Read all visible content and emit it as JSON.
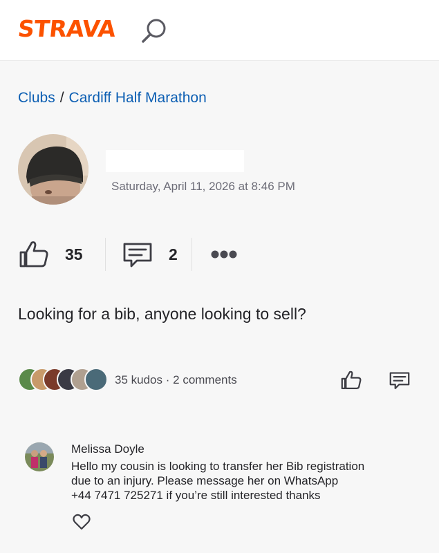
{
  "app": {
    "logo_text": "STRAVA",
    "brand_color": "#fc5200",
    "link_color": "#0d5fb3"
  },
  "header": {
    "search_icon": "search-icon"
  },
  "breadcrumb": {
    "parent": "Clubs",
    "separator": "/",
    "current": "Cardiff Half Marathon"
  },
  "post": {
    "author_name": "",
    "timestamp": "Saturday, April 11, 2026 at 8:46 PM",
    "kudos_count": "35",
    "comment_count": "2",
    "text": "Looking for a bib, anyone looking to sell?"
  },
  "engagement": {
    "kudos_label": "35 kudos",
    "separator": "·",
    "comments_label": "2 comments",
    "kudo_avatar_count": 6
  },
  "comments": [
    {
      "author": "Melissa Doyle",
      "lines": [
        "Hello my cousin is looking to transfer her Bib registration",
        "due to an injury. Please message her on WhatsApp",
        "+44 7471 725271 if you’re still interested thanks"
      ]
    }
  ]
}
